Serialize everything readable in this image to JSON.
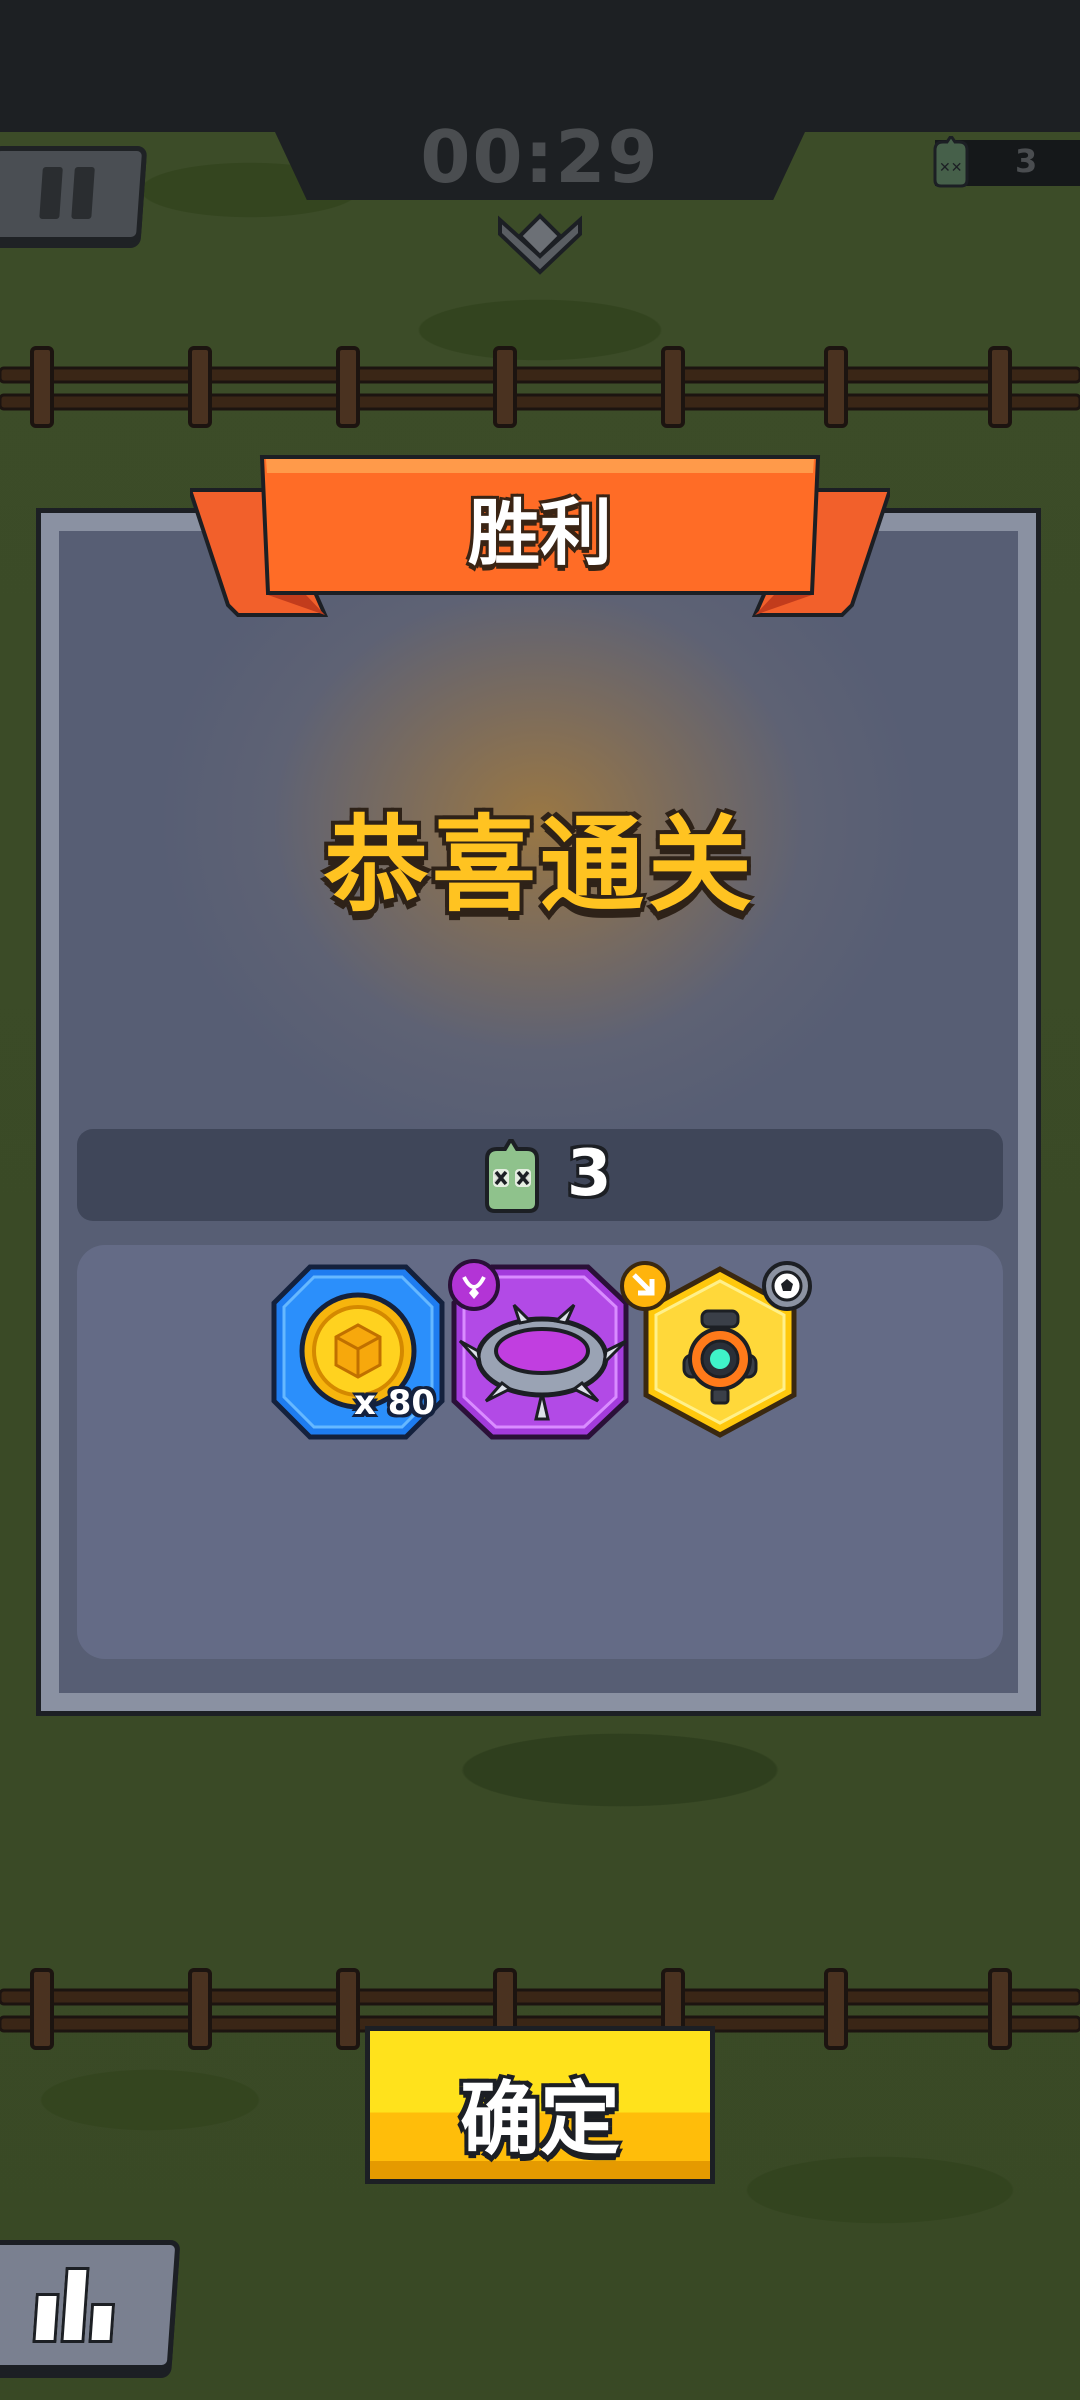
{
  "hud": {
    "timer": "00:29",
    "kill_count": "3"
  },
  "result": {
    "banner_title": "胜利",
    "headline": "恭喜通关",
    "kill_count": "3"
  },
  "rewards": [
    {
      "name": "gold-coin-chest",
      "rarity": "blue",
      "count": "x 80"
    },
    {
      "name": "spiked-collar",
      "rarity": "purple",
      "count": ""
    },
    {
      "name": "turret-module",
      "rarity": "gold",
      "count": ""
    }
  ],
  "buttons": {
    "confirm_label": "确定"
  },
  "colors": {
    "banner": "#ff6a24",
    "headline": "#ffc321",
    "confirm": "#ffd617",
    "rarity_blue": "#1e7cf0",
    "rarity_purple": "#a33bdc",
    "rarity_gold": "#ffc80c"
  }
}
